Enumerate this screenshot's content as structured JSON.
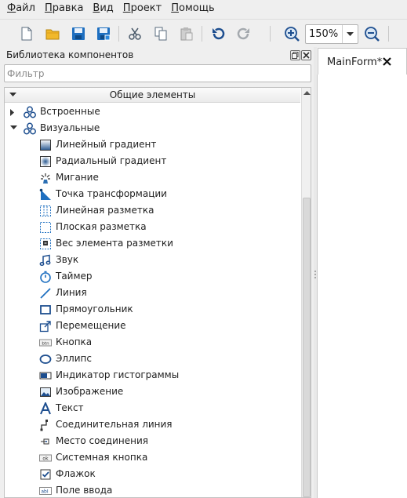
{
  "menu": [
    {
      "accel": "Ф",
      "rest": "айл"
    },
    {
      "accel": "П",
      "rest": "равка"
    },
    {
      "accel": "В",
      "rest": "ид"
    },
    {
      "accel": "П",
      "rest": "роект"
    },
    {
      "accel": "П",
      "rest": "омощь"
    }
  ],
  "toolbar": {
    "buttons": [
      "new-file-icon",
      "open-folder-icon",
      "save-icon",
      "save-all-icon",
      "cut-icon",
      "copy-icon",
      "paste-icon",
      "undo-icon",
      "redo-icon",
      "zoom-in-icon",
      "zoom-out-icon"
    ],
    "zoom_value": "150%"
  },
  "library": {
    "title": "Библиотека компонентов",
    "filter_placeholder": "Фильтр",
    "header": "Общие элементы",
    "categories": [
      {
        "label": "Встроенные",
        "expanded": false
      },
      {
        "label": "Визуальные",
        "expanded": true
      }
    ],
    "items": [
      {
        "label": "Линейный градиент",
        "icon": "linear-gradient-icon"
      },
      {
        "label": "Радиальный градиент",
        "icon": "radial-gradient-icon"
      },
      {
        "label": "Мигание",
        "icon": "blink-icon"
      },
      {
        "label": "Точка трансформации",
        "icon": "transform-point-icon"
      },
      {
        "label": "Линейная разметка",
        "icon": "linear-layout-icon"
      },
      {
        "label": "Плоская разметка",
        "icon": "flat-layout-icon"
      },
      {
        "label": "Вес элемента разметки",
        "icon": "layout-weight-icon"
      },
      {
        "label": "Звук",
        "icon": "sound-icon"
      },
      {
        "label": "Таймер",
        "icon": "timer-icon"
      },
      {
        "label": "Линия",
        "icon": "line-icon"
      },
      {
        "label": "Прямоугольник",
        "icon": "rectangle-icon"
      },
      {
        "label": "Перемещение",
        "icon": "move-icon"
      },
      {
        "label": "Кнопка",
        "icon": "button-icon"
      },
      {
        "label": "Эллипс",
        "icon": "ellipse-icon"
      },
      {
        "label": "Индикатор гистограммы",
        "icon": "histogram-indicator-icon"
      },
      {
        "label": "Изображение",
        "icon": "image-icon"
      },
      {
        "label": "Текст",
        "icon": "text-icon"
      },
      {
        "label": "Соединительная линия",
        "icon": "connector-line-icon"
      },
      {
        "label": "Место соединения",
        "icon": "connection-point-icon"
      },
      {
        "label": "Системная кнопка",
        "icon": "system-button-icon"
      },
      {
        "label": "Флажок",
        "icon": "checkbox-icon"
      },
      {
        "label": "Поле ввода",
        "icon": "input-field-icon"
      }
    ]
  },
  "editor": {
    "tab_label": "MainForm*"
  },
  "colors": {
    "accent_blue": "#1e6fc0",
    "dark_blue": "#1d4e8f",
    "folder_yellow": "#f1b82a"
  }
}
